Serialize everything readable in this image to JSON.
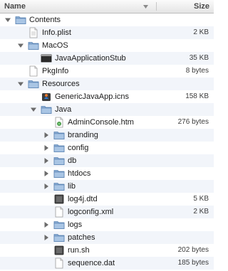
{
  "header": {
    "name_label": "Name",
    "size_label": "Size"
  },
  "rows": [
    {
      "name": "Contents",
      "size": "",
      "depth": 0,
      "kind": "folder",
      "state": "open"
    },
    {
      "name": "Info.plist",
      "size": "2 KB",
      "depth": 1,
      "kind": "plist",
      "state": "none"
    },
    {
      "name": "MacOS",
      "size": "",
      "depth": 1,
      "kind": "folder",
      "state": "open"
    },
    {
      "name": "JavaApplicationStub",
      "size": "35 KB",
      "depth": 2,
      "kind": "exec",
      "state": "none"
    },
    {
      "name": "PkgInfo",
      "size": "8 bytes",
      "depth": 1,
      "kind": "doc",
      "state": "none"
    },
    {
      "name": "Resources",
      "size": "",
      "depth": 1,
      "kind": "folder",
      "state": "open"
    },
    {
      "name": "GenericJavaApp.icns",
      "size": "158 KB",
      "depth": 2,
      "kind": "icns",
      "state": "none"
    },
    {
      "name": "Java",
      "size": "",
      "depth": 2,
      "kind": "folder",
      "state": "open"
    },
    {
      "name": "AdminConsole.htm",
      "size": "276 bytes",
      "depth": 3,
      "kind": "htm",
      "state": "none"
    },
    {
      "name": "branding",
      "size": "",
      "depth": 3,
      "kind": "folder",
      "state": "closed"
    },
    {
      "name": "config",
      "size": "",
      "depth": 3,
      "kind": "folder",
      "state": "closed"
    },
    {
      "name": "db",
      "size": "",
      "depth": 3,
      "kind": "folder",
      "state": "closed"
    },
    {
      "name": "htdocs",
      "size": "",
      "depth": 3,
      "kind": "folder",
      "state": "closed"
    },
    {
      "name": "lib",
      "size": "",
      "depth": 3,
      "kind": "folder",
      "state": "closed"
    },
    {
      "name": "log4j.dtd",
      "size": "5 KB",
      "depth": 3,
      "kind": "dark",
      "state": "none"
    },
    {
      "name": "logconfig.xml",
      "size": "2 KB",
      "depth": 3,
      "kind": "doc",
      "state": "none"
    },
    {
      "name": "logs",
      "size": "",
      "depth": 3,
      "kind": "folder",
      "state": "closed"
    },
    {
      "name": "patches",
      "size": "",
      "depth": 3,
      "kind": "folder",
      "state": "closed"
    },
    {
      "name": "run.sh",
      "size": "202 bytes",
      "depth": 3,
      "kind": "dark",
      "state": "none"
    },
    {
      "name": "sequence.dat",
      "size": "185 bytes",
      "depth": 3,
      "kind": "doc",
      "state": "none"
    }
  ]
}
